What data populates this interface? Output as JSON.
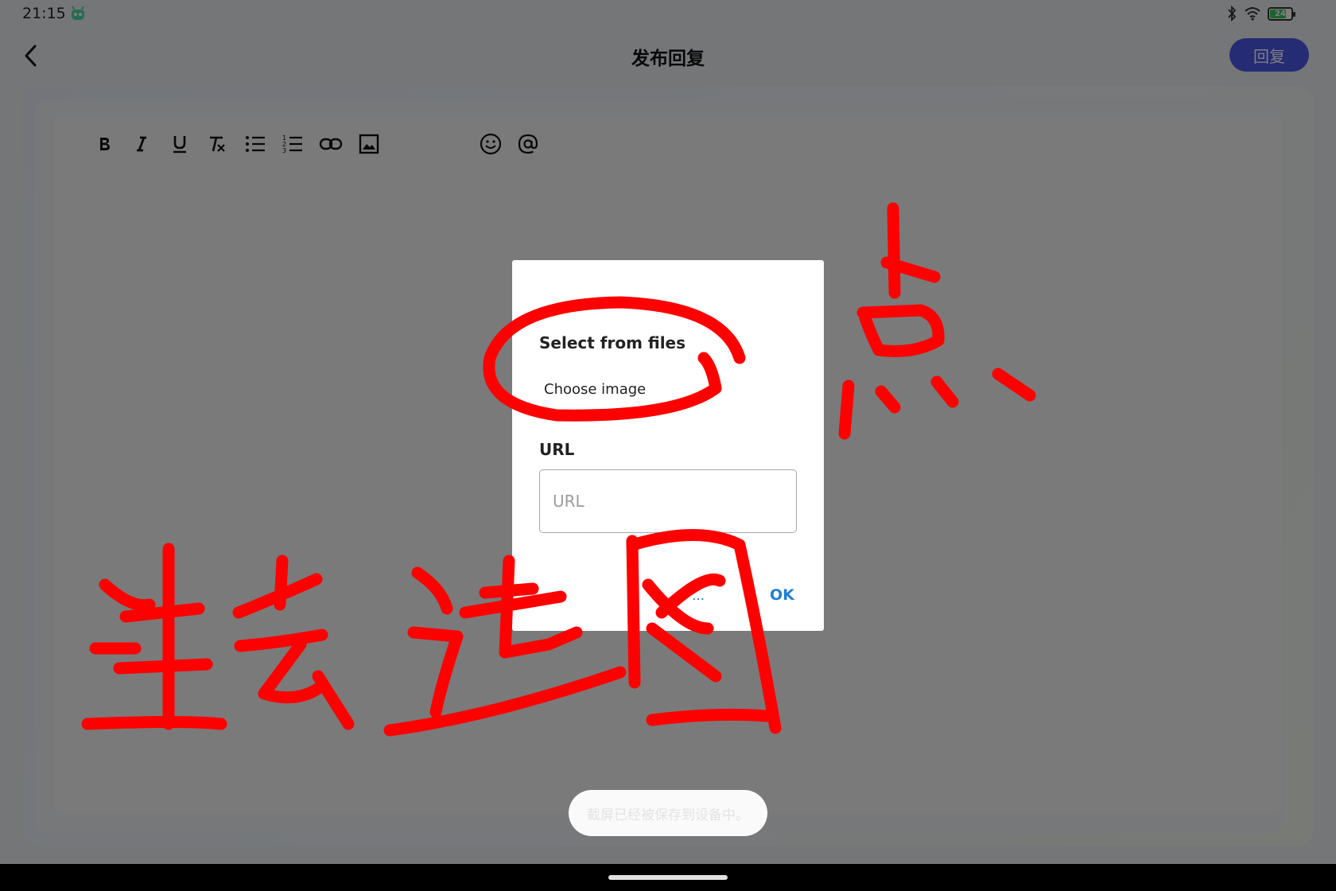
{
  "status_bar": {
    "time": "21:15",
    "battery_level": "24"
  },
  "header": {
    "title": "发布回复",
    "reply_label": "回复"
  },
  "toolbar": {
    "tools": [
      "bold-icon",
      "italic-icon",
      "underline-icon",
      "clear-format-icon",
      "bullet-list-icon",
      "numbered-list-icon",
      "link-icon",
      "image-icon",
      "emoji-icon",
      "mention-icon"
    ]
  },
  "dialog": {
    "files_title": "Select from files",
    "choose_image_label": "Choose image",
    "url_label": "URL",
    "url_placeholder": "URL",
    "url_value": "",
    "cancel_label": "...",
    "ok_label": "OK"
  },
  "toast": {
    "message": "截屏已经被保存到设备中。"
  },
  "colors": {
    "accent": "#4a58e8",
    "dialog_action": "#1e7fd6",
    "annotation": "#ff0000"
  },
  "annotation": {
    "note": "点进去选图"
  }
}
